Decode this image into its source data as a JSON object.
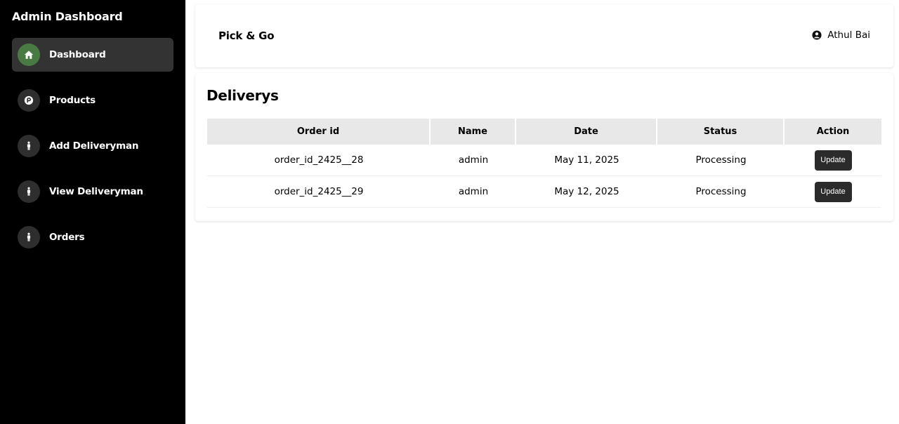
{
  "sidebar": {
    "title": "Admin Dashboard",
    "items": [
      {
        "label": "Dashboard",
        "icon": "home-icon",
        "active": true
      },
      {
        "label": "Products",
        "icon": "product-icon"
      },
      {
        "label": "Add Deliveryman",
        "icon": "person-icon"
      },
      {
        "label": "View Deliveryman",
        "icon": "person-icon"
      },
      {
        "label": "Orders",
        "icon": "person-icon"
      }
    ]
  },
  "header": {
    "brand": "Pick & Go",
    "user_name": "Athul Bai",
    "user_icon": "user-circle-icon"
  },
  "main": {
    "title": "Deliverys",
    "table": {
      "columns": [
        "Order id",
        "Name",
        "Date",
        "Status",
        "Action"
      ],
      "rows": [
        {
          "order_id": "order_id_2425__28",
          "name": "admin",
          "date": "May 11, 2025",
          "status": "Processing",
          "action": "Update"
        },
        {
          "order_id": "order_id_2425__29",
          "name": "admin",
          "date": "May 12, 2025",
          "status": "Processing",
          "action": "Update"
        }
      ]
    }
  },
  "colors": {
    "sidebar_bg": "#000000",
    "active_item_bg": "#333333",
    "active_icon_bg": "#4a7a43",
    "table_header_bg": "#e8e8e8",
    "button_bg": "#2b2b2b"
  }
}
